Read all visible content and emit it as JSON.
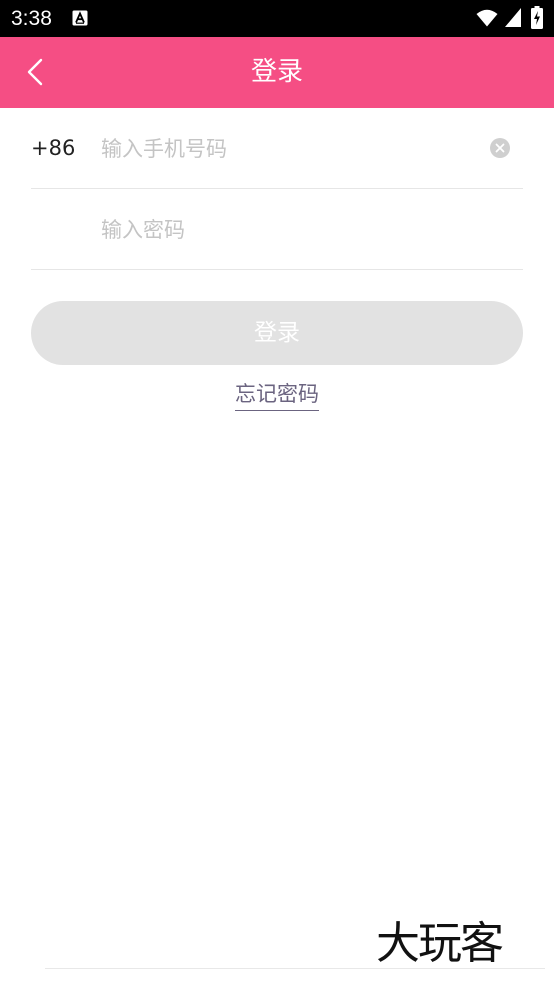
{
  "status_bar": {
    "time": "3:38",
    "notification_icon": "a-letter-icon",
    "wifi_icon": "wifi-icon",
    "signal_icon": "signal-icon",
    "battery_icon": "battery-charging-icon"
  },
  "header": {
    "title": "登录",
    "back_icon": "chevron-left-icon",
    "background_color": "#f54e84"
  },
  "form": {
    "country_code": "+86",
    "phone": {
      "value": "",
      "placeholder": "输入手机号码",
      "clear_icon": "clear-circle-icon"
    },
    "password": {
      "value": "",
      "placeholder": "输入密码"
    },
    "login_button_label": "登录",
    "login_button_color": "#e2e2e2",
    "forgot_password_label": "忘记密码"
  },
  "watermark": "大玩客"
}
